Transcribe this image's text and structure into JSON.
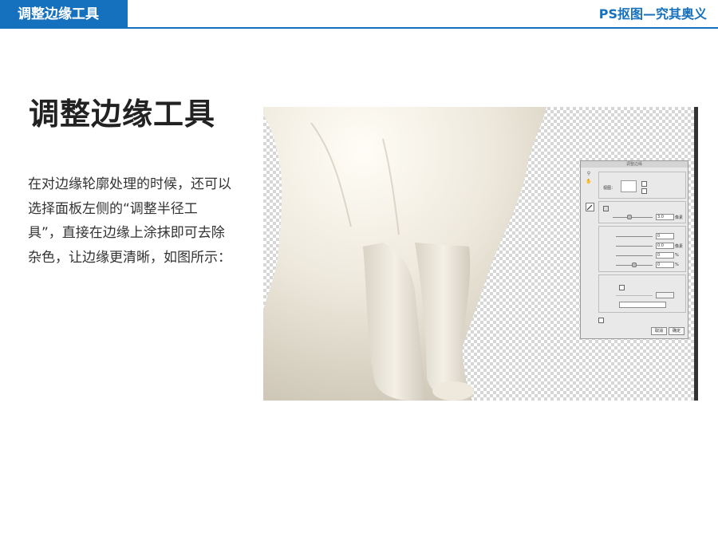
{
  "header": {
    "section_title": "调整边缘工具",
    "course_title": "PS抠图—究其奥义"
  },
  "main": {
    "heading": "调整边缘工具",
    "paragraph": "在对边缘轮廓处理的时候，还可以选择面板左侧的“调整半径工具”，直接在边缘上涂抹即可去除杂色，让边缘更清晰，如图所示："
  },
  "dialog": {
    "title": "调整边缘",
    "view_label": "视图：",
    "radius_value": "3.0",
    "radius_unit": "像素",
    "smooth_value": "0",
    "feather_value": "0.0",
    "feather_unit": "像素",
    "contrast_value": "0",
    "contrast_unit": "%",
    "shift_value": "0",
    "shift_unit": "%",
    "cancel_label": "取消",
    "ok_label": "确定"
  },
  "colors": {
    "accent": "#1570be"
  }
}
